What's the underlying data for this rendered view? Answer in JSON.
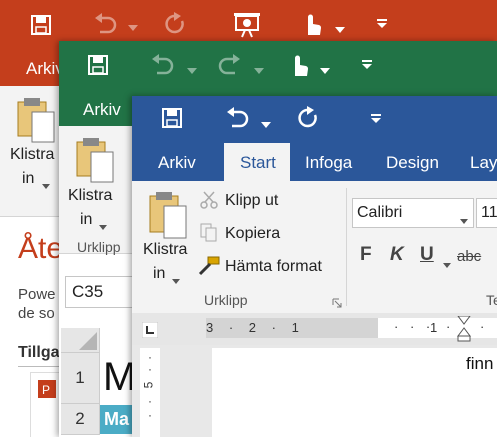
{
  "colors": {
    "powerpoint": "#c43e1c",
    "excel": "#217346",
    "word": "#2b579a",
    "ribbon": "#f3f3f3",
    "accent_pp": "#c43e1c",
    "excel_cell_fill": "#4bacc6"
  },
  "powerpoint": {
    "tab_arkiv": "Arkiv",
    "paste_line1": "Klistra",
    "paste_line2": "in",
    "heading": "Åte",
    "body_line1": "Powe",
    "body_line2": "de so",
    "section": "Tillga"
  },
  "excel": {
    "tab_arkiv": "Arkiv",
    "paste_line1": "Klistra",
    "paste_line2": "in",
    "group_clipboard": "Urklipp",
    "name_box": "C35",
    "row1": "1",
    "row2": "2",
    "cell_a1": "M",
    "cell_a2": "Ma"
  },
  "word": {
    "tabs": {
      "arkiv": "Arkiv",
      "start": "Start",
      "infoga": "Infoga",
      "design": "Design",
      "layout": "Lay"
    },
    "clipboard": {
      "paste_line1": "Klistra",
      "paste_line2": "in",
      "cut": "Klipp ut",
      "copy": "Kopiera",
      "format_painter": "Hämta format",
      "group": "Urklipp"
    },
    "font": {
      "name": "Calibri",
      "size": "11",
      "bold": "F",
      "italic": "K",
      "underline": "U",
      "strike": "abc",
      "group_partial": "Te"
    },
    "ruler": {
      "marks_left": "3 · 2 · 1",
      "mark_right": "1"
    },
    "vruler_mark": "5",
    "doc_text": "finn"
  }
}
